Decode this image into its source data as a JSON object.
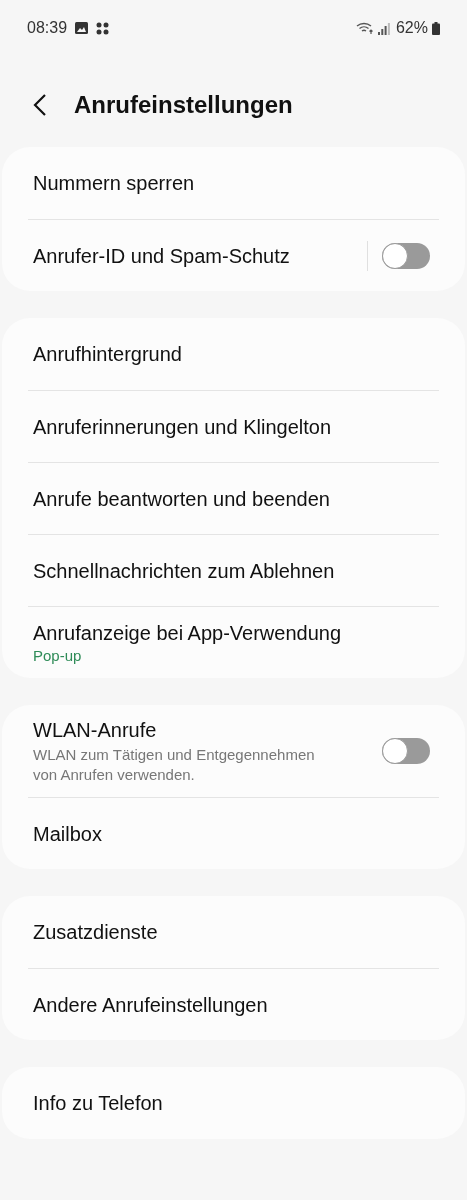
{
  "status_bar": {
    "time": "08:39",
    "battery": "62%"
  },
  "header": {
    "title": "Anrufeinstellungen"
  },
  "groups": [
    {
      "items": [
        {
          "kind": "link",
          "label": "Nummern sperren"
        },
        {
          "kind": "switch",
          "label": "Anrufer-ID und Spam-Schutz",
          "on": false,
          "separator": true
        }
      ]
    },
    {
      "items": [
        {
          "kind": "link",
          "label": "Anrufhintergrund"
        },
        {
          "kind": "link",
          "label": "Anruferinnerungen und Klingelton"
        },
        {
          "kind": "link",
          "label": "Anrufe beantworten und beenden"
        },
        {
          "kind": "link",
          "label": "Schnellnachrichten zum Ablehnen"
        },
        {
          "kind": "link",
          "label": "Anrufanzeige bei App-Verwendung",
          "value": "Pop-up"
        }
      ]
    },
    {
      "items": [
        {
          "kind": "switch",
          "label": "WLAN-Anrufe",
          "description": "WLAN zum Tätigen und Entgegennehmen von Anrufen verwenden.",
          "on": false,
          "separator": false
        },
        {
          "kind": "link",
          "label": "Mailbox"
        }
      ]
    },
    {
      "items": [
        {
          "kind": "link",
          "label": "Zusatzdienste"
        },
        {
          "kind": "link",
          "label": "Andere Anrufeinstellungen"
        }
      ]
    },
    {
      "items": [
        {
          "kind": "link",
          "label": "Info zu Telefon"
        }
      ]
    }
  ]
}
